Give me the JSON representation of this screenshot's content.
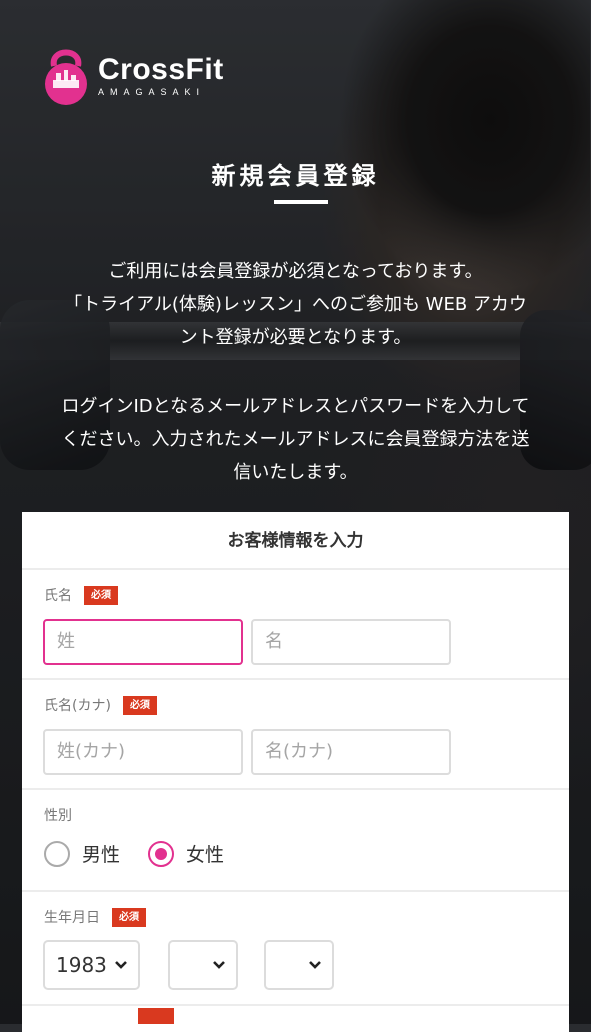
{
  "brand": {
    "name": "CrossFit",
    "sub": "AMAGASAKI",
    "accent": "#e2318f",
    "required_color": "#d9391f"
  },
  "hero": {
    "title": "新規会員登録",
    "intro1_lines": [
      "ご利用には会員登録が必須となっております。",
      "「トライアル(体験)レッスン」へのご参加も WEB アカウ",
      "ント登録が必要となります。"
    ],
    "intro2_lines": [
      "ログインIDとなるメールアドレスとパスワードを入力して",
      "ください。入力されたメールアドレスに会員登録方法を送",
      "信いたします。"
    ]
  },
  "form": {
    "title": "お客様情報を入力",
    "required_label": "必須",
    "name": {
      "label": "氏名",
      "last_placeholder": "姓",
      "first_placeholder": "名"
    },
    "kana": {
      "label": "氏名(カナ)",
      "last_placeholder": "姓(カナ)",
      "first_placeholder": "名(カナ)"
    },
    "gender": {
      "label": "性別",
      "options": [
        "男性",
        "女性"
      ],
      "selected": "女性"
    },
    "birth": {
      "label": "生年月日",
      "year": "1983",
      "month": "",
      "day": ""
    }
  }
}
